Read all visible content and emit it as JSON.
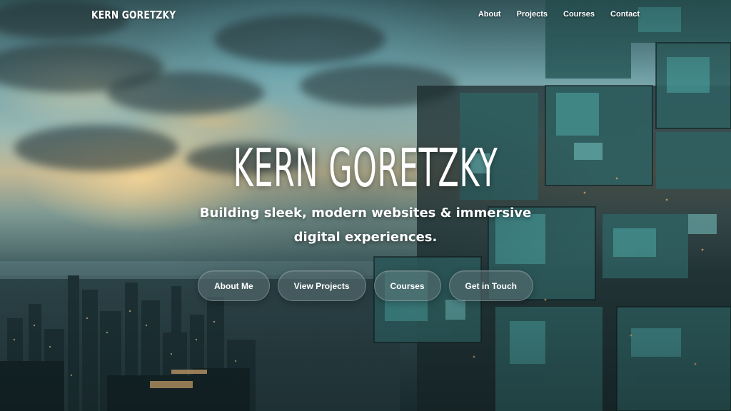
{
  "header": {
    "brand": "KERN GORETZKY",
    "nav": [
      {
        "label": "About"
      },
      {
        "label": "Projects"
      },
      {
        "label": "Courses"
      },
      {
        "label": "Contact"
      }
    ]
  },
  "hero": {
    "title": "KERN GORETZKY",
    "subtitle": "Building sleek, modern websites & immersive digital experiences.",
    "background": "sunset-clouds-city-skyline-digital-mosaic",
    "buttons": [
      {
        "label": "About Me"
      },
      {
        "label": "View Projects"
      },
      {
        "label": "Courses"
      },
      {
        "label": "Get in Touch"
      }
    ]
  },
  "colors": {
    "text": "#ffffff",
    "button_bg": "#566c70",
    "accent_teal": "#4fa8a6",
    "sky_glow": "#f8d696"
  }
}
